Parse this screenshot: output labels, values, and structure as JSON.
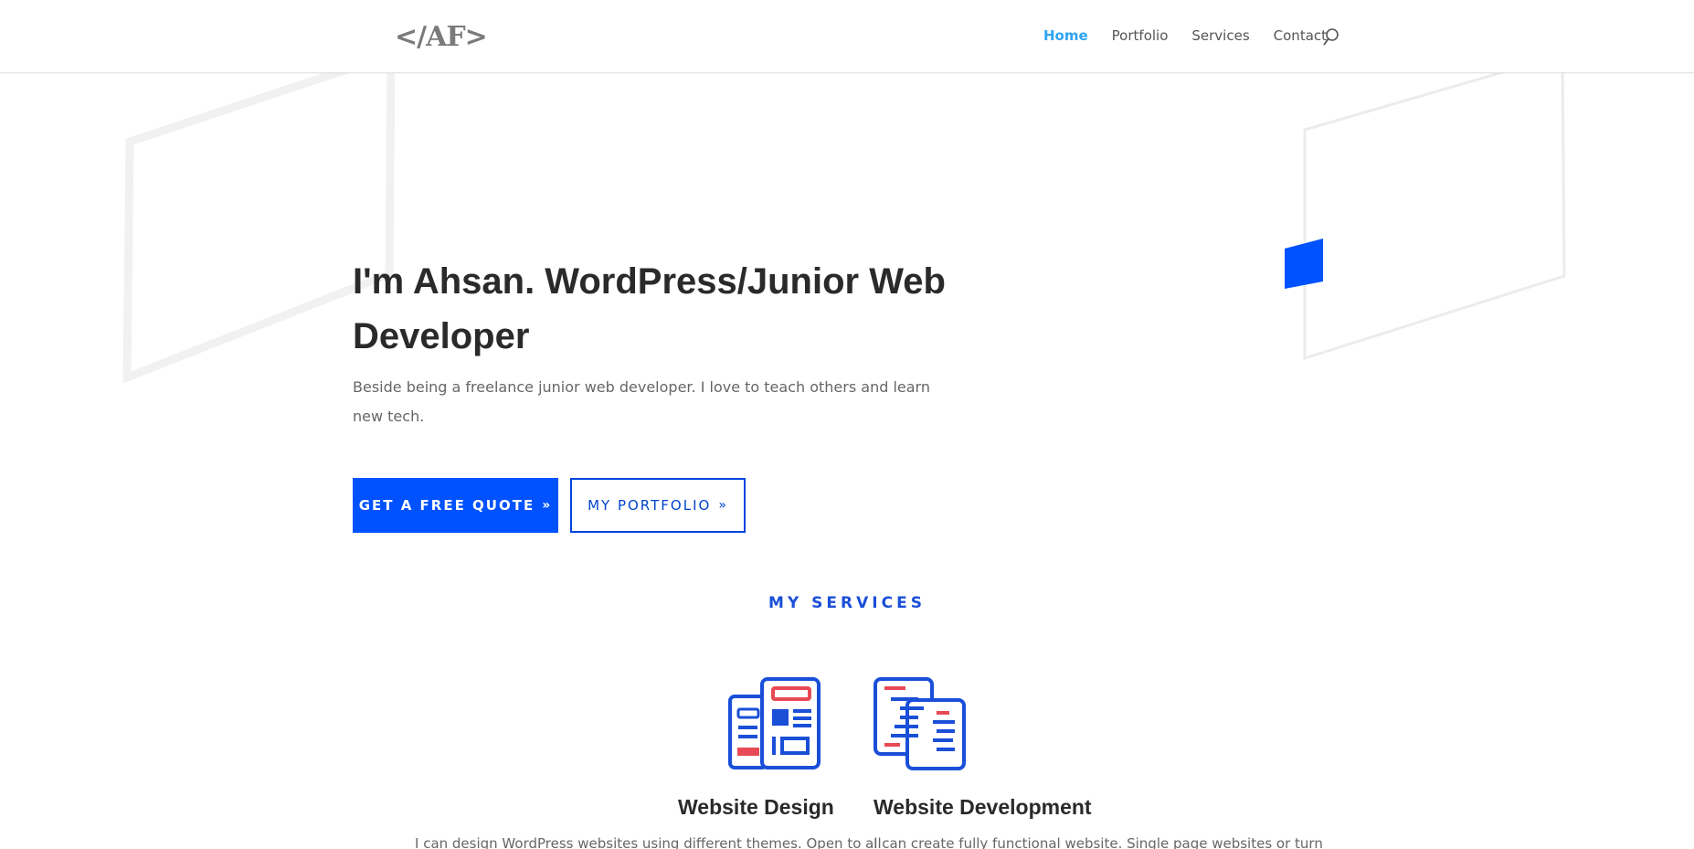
{
  "header": {
    "logo_text": "</AF>",
    "nav": [
      {
        "label": "Home",
        "active": true
      },
      {
        "label": "Portfolio",
        "active": false
      },
      {
        "label": "Services",
        "active": false
      },
      {
        "label": "Contact",
        "active": false
      }
    ]
  },
  "hero": {
    "title": "I'm Ahsan. WordPress/Junior Web Developer",
    "subtitle": "Beside being a freelance junior web developer. I love to teach others and learn new tech.",
    "primary_button": "GET A FREE QUOTE",
    "secondary_button": "MY PORTFOLIO"
  },
  "services": {
    "heading": "MY SERVICES",
    "items": [
      {
        "title": "Website Design",
        "text": "I can design WordPress websites using different themes. Open to all",
        "icon": "website-design-icon"
      },
      {
        "title": "Website Development",
        "text": "I can create fully functional website. Single page websites or turn",
        "icon": "website-development-icon"
      }
    ]
  },
  "colors": {
    "accent": "#0052ff",
    "nav_active": "#2ea3f2",
    "heading_blue": "#1a4fd8",
    "icon_red": "#e84a55"
  }
}
